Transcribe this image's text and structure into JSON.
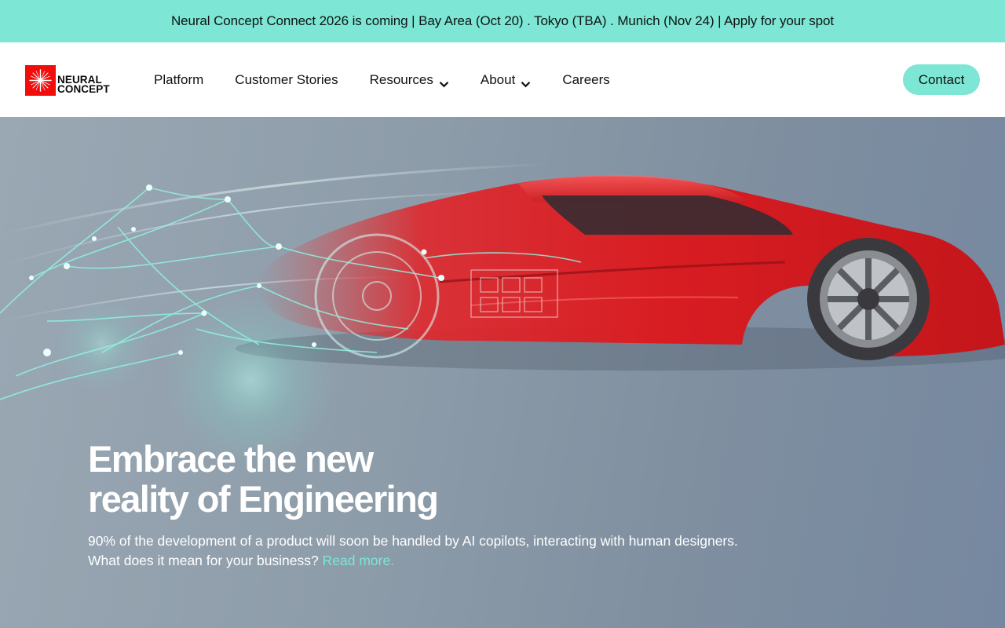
{
  "announcement": {
    "text": "Neural Concept Connect 2026 is coming | Bay Area (Oct 20) . Tokyo (TBA) . Munich (Nov 24)  | Apply for your spot"
  },
  "header": {
    "logo_line1": "NEURAL",
    "logo_line2": "CONCEPT",
    "nav": [
      {
        "label": "Platform",
        "has_dropdown": false
      },
      {
        "label": "Customer Stories",
        "has_dropdown": false
      },
      {
        "label": "Resources",
        "has_dropdown": true
      },
      {
        "label": "About",
        "has_dropdown": true
      },
      {
        "label": "Careers",
        "has_dropdown": false
      }
    ],
    "contact_label": "Contact"
  },
  "hero": {
    "title_line1": "Embrace the new",
    "title_line2": "reality of Engineering",
    "subtitle_line1": "90% of the development of a product will soon be handled by AI copilots, interacting with human designers.",
    "subtitle_line2": "What does it mean for your business?",
    "read_more": "Read more."
  },
  "colors": {
    "accent": "#7de6d4",
    "brand_red": "#f20d0d",
    "car_red": "#d81d22"
  },
  "icons": {
    "logo": "starburst-icon",
    "dropdown": "chevron-down-icon"
  }
}
